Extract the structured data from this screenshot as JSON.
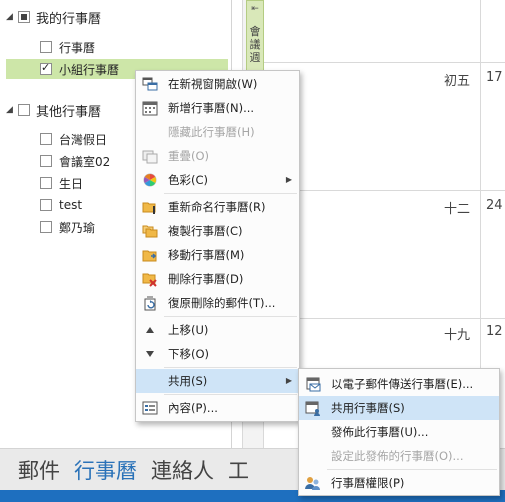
{
  "folder_pane": {
    "my_calendars": {
      "label": "我的行事曆",
      "items": [
        {
          "label": "行事曆"
        },
        {
          "label": "小組行事曆"
        }
      ]
    },
    "other_calendars": {
      "label": "其他行事曆",
      "items": [
        {
          "label": "台灣假日"
        },
        {
          "label": "會議室02"
        },
        {
          "label": "生日"
        },
        {
          "label": "test"
        },
        {
          "label": "鄭乃瑜"
        }
      ]
    }
  },
  "calendar": {
    "week_tab_label": "會議週",
    "rows": [
      {
        "day": "初五",
        "date": "17"
      },
      {
        "day": "十二",
        "date": "24"
      },
      {
        "day": "十九",
        "date": "12"
      }
    ]
  },
  "context_menu": {
    "items": [
      {
        "label": "在新視窗開啟(W)",
        "icon": "new-window-icon"
      },
      {
        "label": "新增行事曆(N)...",
        "icon": "new-calendar-icon"
      },
      {
        "label": "隱藏此行事曆(H)",
        "icon": "none"
      },
      {
        "label": "重疊(O)",
        "icon": "overlay-icon"
      },
      {
        "label": "色彩(C)",
        "icon": "color-palette-icon"
      },
      {
        "label": "重新命名行事曆(R)",
        "icon": "rename-folder-icon"
      },
      {
        "label": "複製行事曆(C)",
        "icon": "copy-folder-icon"
      },
      {
        "label": "移動行事曆(M)",
        "icon": "move-folder-icon"
      },
      {
        "label": "刪除行事曆(D)",
        "icon": "delete-folder-icon"
      },
      {
        "label": "復原刪除的郵件(T)...",
        "icon": "recover-icon"
      },
      {
        "label": "上移(U)",
        "icon": "up-arrow-icon"
      },
      {
        "label": "下移(O)",
        "icon": "down-arrow-icon"
      },
      {
        "label": "共用(S)",
        "icon": "none"
      },
      {
        "label": "內容(P)...",
        "icon": "properties-icon"
      }
    ]
  },
  "share_submenu": {
    "items": [
      {
        "label": "以電子郵件傳送行事曆(E)...",
        "icon": "email-calendar-icon"
      },
      {
        "label": "共用行事曆(S)",
        "icon": "share-calendar-icon"
      },
      {
        "label": "發佈此行事曆(U)...",
        "icon": "none"
      },
      {
        "label": "設定此發佈的行事曆(O)...",
        "icon": "none"
      },
      {
        "label": "行事曆權限(P)",
        "icon": "permissions-icon"
      }
    ]
  },
  "bottom_nav": {
    "items": [
      {
        "label": "郵件"
      },
      {
        "label": "行事曆"
      },
      {
        "label": "連絡人"
      },
      {
        "label": "工"
      }
    ]
  },
  "colors": {
    "selected_item_bg": "#cde6a8",
    "menu_highlight": "#cfe4f7",
    "nav_active": "#2a72b8",
    "status_bar": "#1e6fbf",
    "disabled_text": "#a6a6a6"
  }
}
